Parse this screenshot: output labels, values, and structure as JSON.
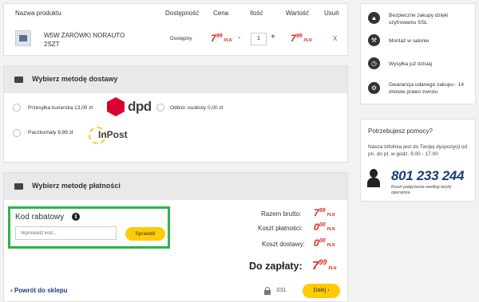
{
  "cart": {
    "headers": {
      "product": "Nazwa produktu",
      "availability": "Dostępność",
      "price": "Cena",
      "quantity": "Ilość",
      "value": "Wartość",
      "remove": "Usuń"
    },
    "items": [
      {
        "name": "W5W ŻARÓWKI NORAUTO 2SZT",
        "availability": "Dostępny",
        "price_int": "7",
        "price_dec": "99",
        "price_currency": "PLN",
        "qty_minus": "-",
        "quantity": "1",
        "qty_plus": "+",
        "value_int": "7",
        "value_dec": "99",
        "value_currency": "PLN",
        "remove": "X"
      }
    ]
  },
  "shipping": {
    "title": "Wybierz metodę dostawy",
    "options": [
      {
        "label": "Przesyłka kurierska 13,00 zł",
        "logo": "dpd"
      },
      {
        "label": "Odbiór osobisty 0,00 zł"
      },
      {
        "label": "Paczkomaty 9,99 zł",
        "logo": "InPost"
      }
    ]
  },
  "payment": {
    "title": "Wybierz metodę płatności",
    "coupon": {
      "title": "Kod rabatowy",
      "info_glyph": "i",
      "placeholder": "Wprowadź kod...",
      "button": "Sprawdź"
    },
    "summary": [
      {
        "label": "Razem brutto:",
        "int": "7",
        "dec": "99",
        "currency": "PLN"
      },
      {
        "label": "Koszt płatności:",
        "int": "0",
        "dec": "00",
        "currency": "PLN"
      },
      {
        "label": "Koszt dostawy:",
        "int": "0",
        "dec": "00",
        "currency": "PLN"
      }
    ],
    "total": {
      "label": "Do zapłaty:",
      "int": "7",
      "dec": "99",
      "currency": "PLN"
    },
    "back_link": "‹  Powrót do sklepu",
    "ssl": "SSL",
    "next_button": "Dalej ›"
  },
  "benefits": [
    {
      "icon": "lock-icon",
      "text": "Bezpieczne zakupy dzięki szyfrowaniu SSL"
    },
    {
      "icon": "wrench-icon",
      "text": "Montaż w salonie"
    },
    {
      "icon": "clock-icon",
      "text": "Wysyłka już dzisiaj"
    },
    {
      "icon": "gear-badge-icon",
      "text": "Gwarancja udanego zakupu - 14 dniowe prawo zwrotu"
    }
  ],
  "help": {
    "title": "Potrzebujesz pomocy?",
    "text": "Nasza infolinia jest do Twojej dyspozycji od pn. do pt. w godz. 9.00 - 17.00",
    "phone": "801 233 244",
    "phone_note": "Koszt połączenia według taryfy operatora."
  },
  "colors": {
    "accent_yellow": "#ffcb04",
    "price_red": "#e1251b",
    "highlight_green": "#2db34a",
    "link_blue": "#1b3e7a"
  }
}
